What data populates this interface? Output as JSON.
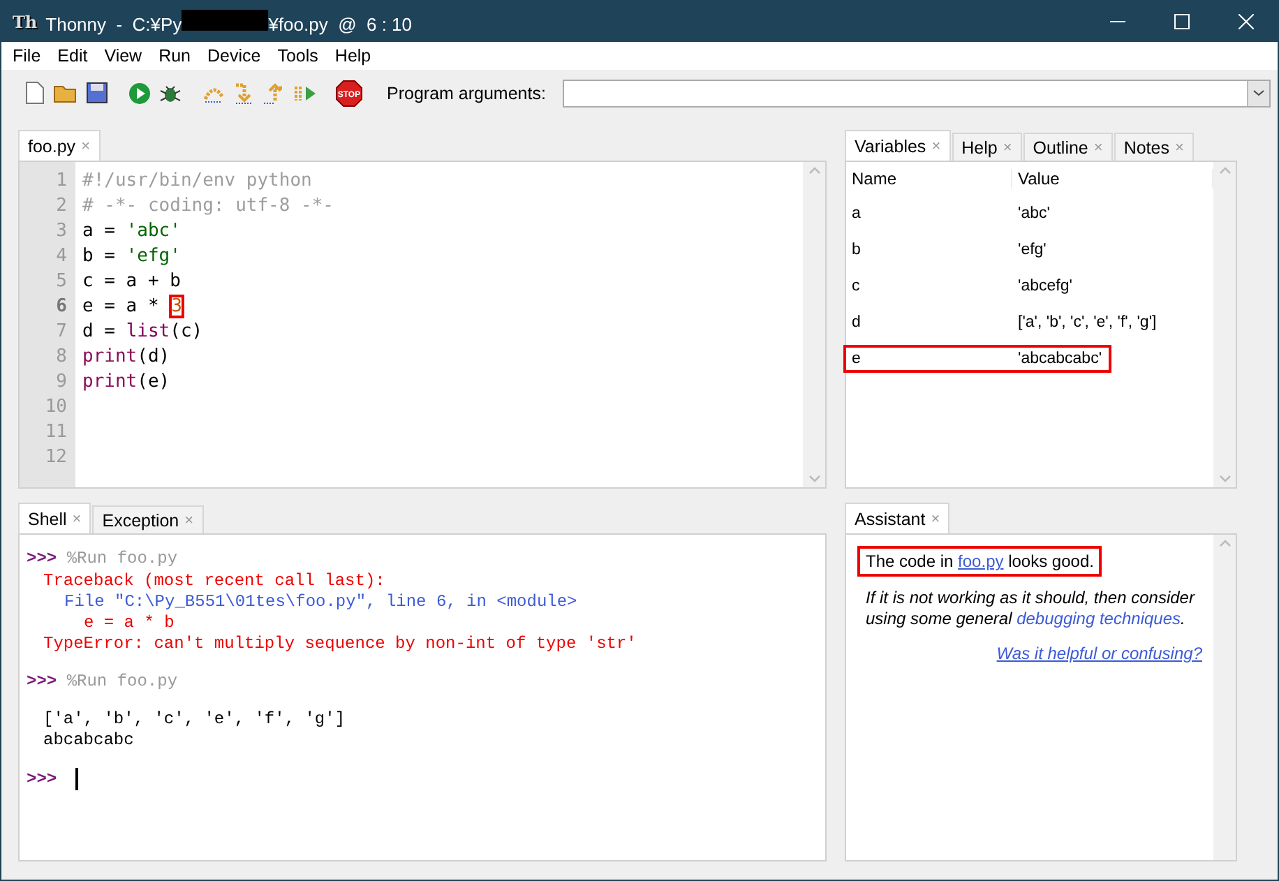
{
  "window": {
    "logo": "Th",
    "title_start": "Thonny  -  C:¥Py",
    "redacted": true,
    "title_end": "¥foo.py  @  6 : 10"
  },
  "menu": [
    "File",
    "Edit",
    "View",
    "Run",
    "Device",
    "Tools",
    "Help"
  ],
  "toolbar": {
    "groups": [
      [
        {
          "kind": "new"
        },
        {
          "kind": "open"
        },
        {
          "kind": "save"
        }
      ],
      [
        {
          "kind": "run"
        },
        {
          "kind": "debug"
        }
      ],
      [
        {
          "kind": "step_over"
        },
        {
          "kind": "step_into"
        },
        {
          "kind": "step_out"
        },
        {
          "kind": "resume"
        }
      ],
      [
        {
          "kind": "stop",
          "label": "STOP"
        }
      ]
    ],
    "args_label": "Program arguments:"
  },
  "editor": {
    "tabs": [
      {
        "label": "foo.py",
        "close": "×",
        "selected": true
      }
    ],
    "lines": [
      {
        "number": "1",
        "current": false,
        "tokens": [
          {
            "kind": "comment",
            "text": "#!/usr/bin/env python"
          }
        ]
      },
      {
        "number": "2",
        "current": false,
        "tokens": [
          {
            "kind": "comment",
            "text": "# -*- coding: utf-8 -*-"
          }
        ]
      },
      {
        "number": "3",
        "current": false,
        "tokens": [
          {
            "kind": "plain",
            "text": "a = "
          },
          {
            "kind": "string",
            "text": "'abc'"
          }
        ]
      },
      {
        "number": "4",
        "current": false,
        "tokens": [
          {
            "kind": "plain",
            "text": "b = "
          },
          {
            "kind": "string",
            "text": "'efg'"
          }
        ]
      },
      {
        "number": "5",
        "current": false,
        "tokens": [
          {
            "kind": "plain",
            "text": "c = a + b"
          }
        ]
      },
      {
        "number": "6",
        "current": true,
        "tokens": [
          {
            "kind": "plain",
            "text": "e = a * "
          },
          {
            "kind": "number",
            "text": "3",
            "highlighted": true
          }
        ]
      },
      {
        "number": "7",
        "current": false,
        "tokens": [
          {
            "kind": "plain",
            "text": "d = "
          },
          {
            "kind": "builtin",
            "text": "list"
          },
          {
            "kind": "plain",
            "text": "(c)"
          }
        ]
      },
      {
        "number": "8",
        "current": false,
        "tokens": [
          {
            "kind": "keyword",
            "text": "print"
          },
          {
            "kind": "plain",
            "text": "(d)"
          }
        ]
      },
      {
        "number": "9",
        "current": false,
        "tokens": [
          {
            "kind": "keyword",
            "text": "print"
          },
          {
            "kind": "plain",
            "text": "(e)"
          }
        ]
      },
      {
        "number": "10",
        "current": false
      },
      {
        "number": "11",
        "current": false
      },
      {
        "number": "12",
        "current": false
      }
    ]
  },
  "variables_panel": {
    "tabs": [
      {
        "label": "Variables",
        "close": "×",
        "selected": true
      },
      {
        "label": "Help",
        "close": "×",
        "selected": false
      },
      {
        "label": "Outline",
        "close": "×",
        "selected": false
      },
      {
        "label": "Notes",
        "close": "×",
        "selected": false
      }
    ],
    "columns": [
      "Name",
      "Value"
    ],
    "rows": [
      {
        "name": "a",
        "value": "'abc'",
        "highlighted": false
      },
      {
        "name": "b",
        "value": "'efg'",
        "highlighted": false
      },
      {
        "name": "c",
        "value": "'abcefg'",
        "highlighted": false
      },
      {
        "name": "d",
        "value": "['a', 'b', 'c', 'e', 'f', 'g']",
        "highlighted": false
      },
      {
        "name": "e",
        "value": "'abcabcabc'",
        "highlighted": true
      }
    ]
  },
  "shell": {
    "tabs": [
      {
        "label": "Shell",
        "close": "×",
        "selected": true
      },
      {
        "label": "Exception",
        "close": "×",
        "selected": false
      }
    ],
    "blocks": [
      {
        "kind": "command",
        "prompt": ">>>",
        "text": "%Run foo.py"
      },
      {
        "kind": "traceback_header",
        "text": "Traceback (most recent call last):"
      },
      {
        "kind": "traceback_file",
        "text": "File \"C:\\Py_B551\\01tes\\foo.py\", line 6, in <module>"
      },
      {
        "kind": "traceback_code",
        "text": "e = a * b"
      },
      {
        "kind": "error",
        "text": "TypeError: can't multiply sequence by non-int of type 'str'"
      },
      {
        "kind": "command",
        "prompt": ">>>",
        "text": "%Run foo.py"
      },
      {
        "kind": "output",
        "text": "['a', 'b', 'c', 'e', 'f', 'g']"
      },
      {
        "kind": "output",
        "text": "abcabcabc"
      },
      {
        "kind": "input",
        "prompt": ">>>"
      }
    ]
  },
  "assistant": {
    "tabs": [
      {
        "label": "Assistant",
        "close": "×",
        "selected": true
      }
    ],
    "summary": {
      "highlighted": true,
      "parts": [
        {
          "kind": "text",
          "text": "The code in "
        },
        {
          "kind": "link",
          "text": "foo.py"
        },
        {
          "kind": "text",
          "text": " looks good."
        }
      ]
    },
    "advice": {
      "parts": [
        {
          "kind": "text",
          "text": "If it is not working as it should, then consider using some general "
        },
        {
          "kind": "link",
          "text": "debugging techniques"
        },
        {
          "kind": "text",
          "text": "."
        }
      ]
    },
    "feedback_link": "Was it helpful or confusing?"
  }
}
